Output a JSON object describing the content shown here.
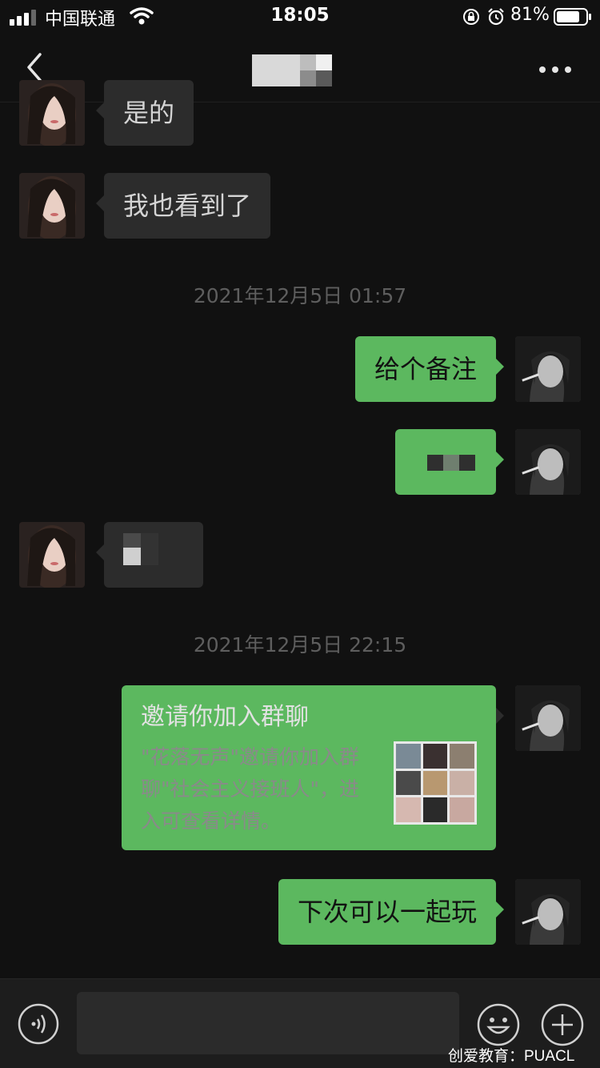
{
  "status_bar": {
    "carrier": "中国联通",
    "time": "18:05",
    "battery_percent": "81%",
    "battery_level": 0.81,
    "icons": [
      "signal-icon",
      "wifi-icon",
      "rotation-lock-icon",
      "alarm-icon",
      "battery-icon"
    ]
  },
  "header": {
    "back_icon": "chevron-left-icon",
    "title_redacted": true,
    "more_icon": "more-dots-icon"
  },
  "messages": [
    {
      "side": "in",
      "text": "是的"
    },
    {
      "side": "in",
      "text": "我也看到了"
    },
    {
      "type": "timestamp",
      "text": "2021年12月5日 01:57"
    },
    {
      "side": "out",
      "text": "给个备注"
    },
    {
      "side": "out",
      "text": "",
      "redacted": true
    },
    {
      "side": "in",
      "text": "",
      "redacted": true
    },
    {
      "type": "timestamp",
      "text": "2021年12月5日 22:15"
    },
    {
      "side": "out",
      "type": "group-invite",
      "title": "邀请你加入群聊",
      "desc": "\"花落无声\"邀请你加入群聊\"社会主义接班人\"，进入可查看详情。"
    },
    {
      "side": "out",
      "text": "下次可以一起玩"
    }
  ],
  "input_bar": {
    "voice_icon": "voice-icon",
    "emoji_icon": "emoji-icon",
    "plus_icon": "plus-icon",
    "text_value": ""
  },
  "watermark": "创爱教育：PUACL",
  "colors": {
    "background": "#111111",
    "incoming_bubble": "#2c2c2c",
    "outgoing_bubble": "#5cb85f",
    "timestamp": "#5e5e5e"
  }
}
